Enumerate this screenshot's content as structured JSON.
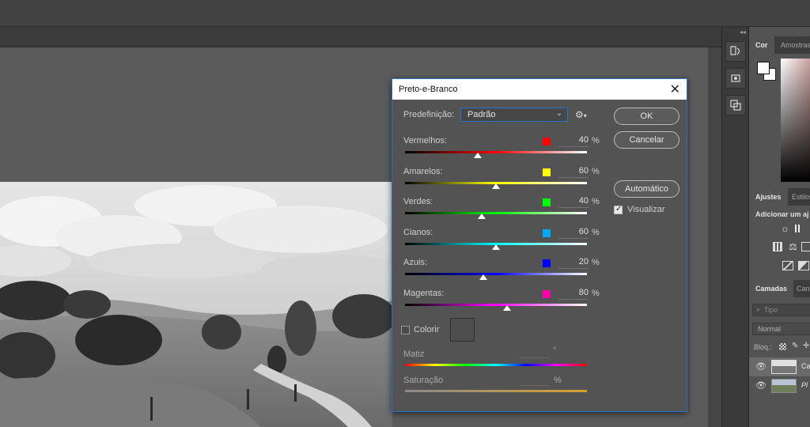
{
  "dialog": {
    "title": "Preto-e-Branco",
    "preset_label": "Predefinição:",
    "preset_value": "Padrão",
    "ok_label": "OK",
    "cancel_label": "Cancelar",
    "auto_label": "Automático",
    "preview_label": "Visualizar",
    "preview_checked": true,
    "tint_label": "Colorir",
    "tint_checked": false,
    "hue_label": "Matiz",
    "hue_unit": "°",
    "sat_label": "Saturação",
    "sat_unit": "%",
    "sliders": [
      {
        "label": "Vermelhos:",
        "value": "40",
        "unit": "%",
        "swatch": "#ff0000",
        "track": [
          "#000000",
          "#ff0000",
          "#ffffff"
        ],
        "position": 0.4
      },
      {
        "label": "Amarelos:",
        "value": "60",
        "unit": "%",
        "swatch": "#ffff00",
        "track": [
          "#000000",
          "#ffff00",
          "#ffffff"
        ],
        "position": 0.5
      },
      {
        "label": "Verdes:",
        "value": "40",
        "unit": "%",
        "swatch": "#00ff00",
        "track": [
          "#000000",
          "#00ff00",
          "#ffffff"
        ],
        "position": 0.42
      },
      {
        "label": "Cianos:",
        "value": "60",
        "unit": "%",
        "swatch": "#00a8ff",
        "track": [
          "#000000",
          "#00ffff",
          "#ffffff"
        ],
        "position": 0.5
      },
      {
        "label": "Azuis:",
        "value": "20",
        "unit": "%",
        "swatch": "#0000ff",
        "track": [
          "#000000",
          "#0000ff",
          "#ffffff"
        ],
        "position": 0.43
      },
      {
        "label": "Magentas:",
        "value": "80",
        "unit": "%",
        "swatch": "#ff00aa",
        "track": [
          "#000000",
          "#ff00ff",
          "#ffffff"
        ],
        "position": 0.56
      }
    ]
  },
  "panels": {
    "color_tabs": [
      "Cor",
      "Amostras"
    ],
    "adjust_tabs": [
      "Ajustes",
      "Estilos"
    ],
    "adjust_hint": "Adicionar um aj",
    "layers_tabs": [
      "Camadas",
      "Cana"
    ],
    "layers_search_placeholder": "Tipo",
    "blend_mode": "Normal",
    "lock_label": "Bloq.:",
    "layers": [
      {
        "name": "Ca",
        "italic": false
      },
      {
        "name": "Pl",
        "italic": true
      }
    ]
  },
  "colors": {
    "accent": "#2a72c8",
    "dialog_bg": "#535353",
    "workspace": "#5b5b5b"
  }
}
